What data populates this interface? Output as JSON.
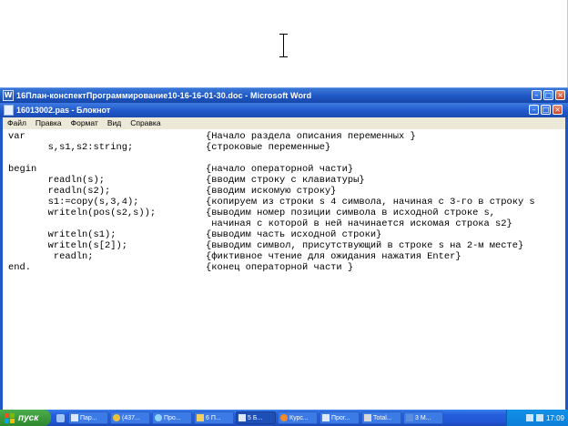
{
  "word": {
    "title": "16План-конспектПрограммирование10-16-16-01-30.doc - Microsoft Word",
    "icon_letter": "W",
    "buttons": [
      "minimize-icon",
      "maximize-icon",
      "close-icon"
    ]
  },
  "notepad": {
    "title": "16013002.pas - Блокнот",
    "menu": [
      "Файл",
      "Правка",
      "Формат",
      "Вид",
      "Справка"
    ],
    "lines": [
      {
        "code": "var",
        "comment": "{Начало раздела описания переменных }"
      },
      {
        "code": "       s,s1,s2:string;",
        "comment": "{строковые переменные}"
      },
      {
        "code": "",
        "comment": ""
      },
      {
        "code": "begin",
        "comment": "{начало операторной части}"
      },
      {
        "code": "       readln(s);",
        "comment": "{вводим строку с клавиатуры}"
      },
      {
        "code": "       readln(s2);",
        "comment": "{вводим искомую строку}"
      },
      {
        "code": "       s1:=copy(s,3,4);",
        "comment": "{копируем из строки s 4 символа, начиная с 3-го в строку s"
      },
      {
        "code": "       writeln(pos(s2,s));",
        "comment": "{выводим номер позиции символа в исходной строке s,"
      },
      {
        "code": "",
        "comment": " начиная с которой в ней начинается искомая строка s2}"
      },
      {
        "code": "       writeln(s1);",
        "comment": "{выводим часть исходной строки}"
      },
      {
        "code": "       writeln(s[2]);",
        "comment": "{выводим символ, присутствующий в строке s на 2-м месте}"
      },
      {
        "code": "        readln;",
        "comment": "{фиктивное чтение для ожидания нажатия Enter}"
      },
      {
        "code": "end.",
        "comment": "{конец операторной части }"
      }
    ]
  },
  "taskbar": {
    "start_label": "пуск",
    "tasks": [
      {
        "label": "Пар...",
        "icon": "window-icon"
      },
      {
        "label": "(437...",
        "icon": "chrome-icon"
      },
      {
        "label": "Про...",
        "icon": "globe-icon"
      },
      {
        "label": "6 П...",
        "icon": "folder-icon"
      },
      {
        "label": "5 Б...",
        "icon": "notepad-icon",
        "active": true
      },
      {
        "label": "Курс...",
        "icon": "firefox-icon"
      },
      {
        "label": "Прог...",
        "icon": "document-icon"
      },
      {
        "label": "Total...",
        "icon": "total-commander-icon"
      },
      {
        "label": "3 M...",
        "icon": "word-icon"
      }
    ],
    "clock": "17:09"
  }
}
